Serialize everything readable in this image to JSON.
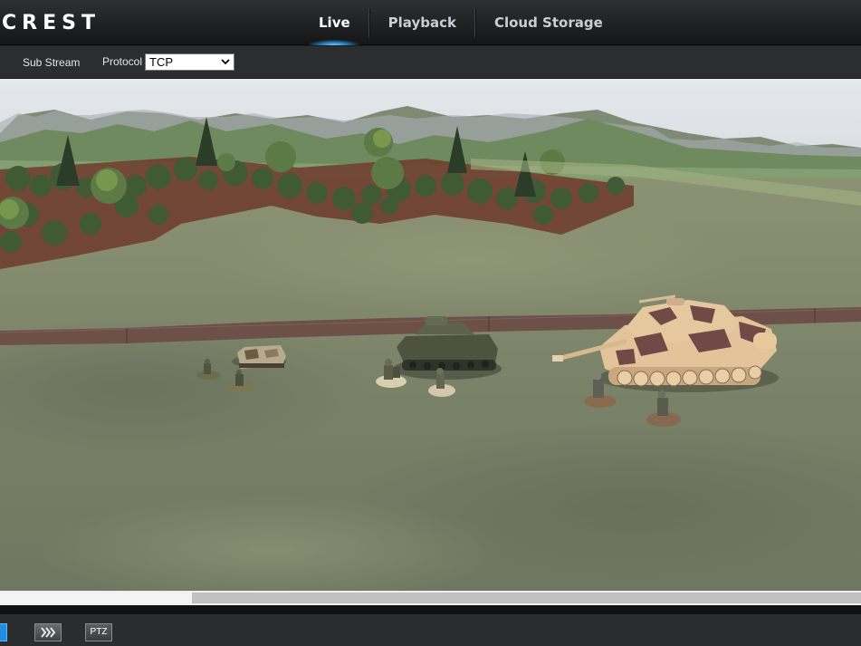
{
  "header": {
    "logo": "CREST",
    "tabs": [
      {
        "label": "Live",
        "active": true
      },
      {
        "label": "Playback",
        "active": false
      },
      {
        "label": "Cloud Storage",
        "active": false
      }
    ]
  },
  "toolbar": {
    "stream_label": "Sub Stream",
    "protocol_label": "Protocol",
    "protocol_value": "TCP"
  },
  "video": {
    "scene": "live camera feed of a tabletop war-game diorama with tanks and soldiers"
  },
  "bottom_bar": {
    "ptz_label": "PTZ"
  },
  "colors": {
    "accent": "#1f8ee0",
    "header_bg": "#1f2123",
    "toolbar_bg": "#2c2d2f"
  }
}
